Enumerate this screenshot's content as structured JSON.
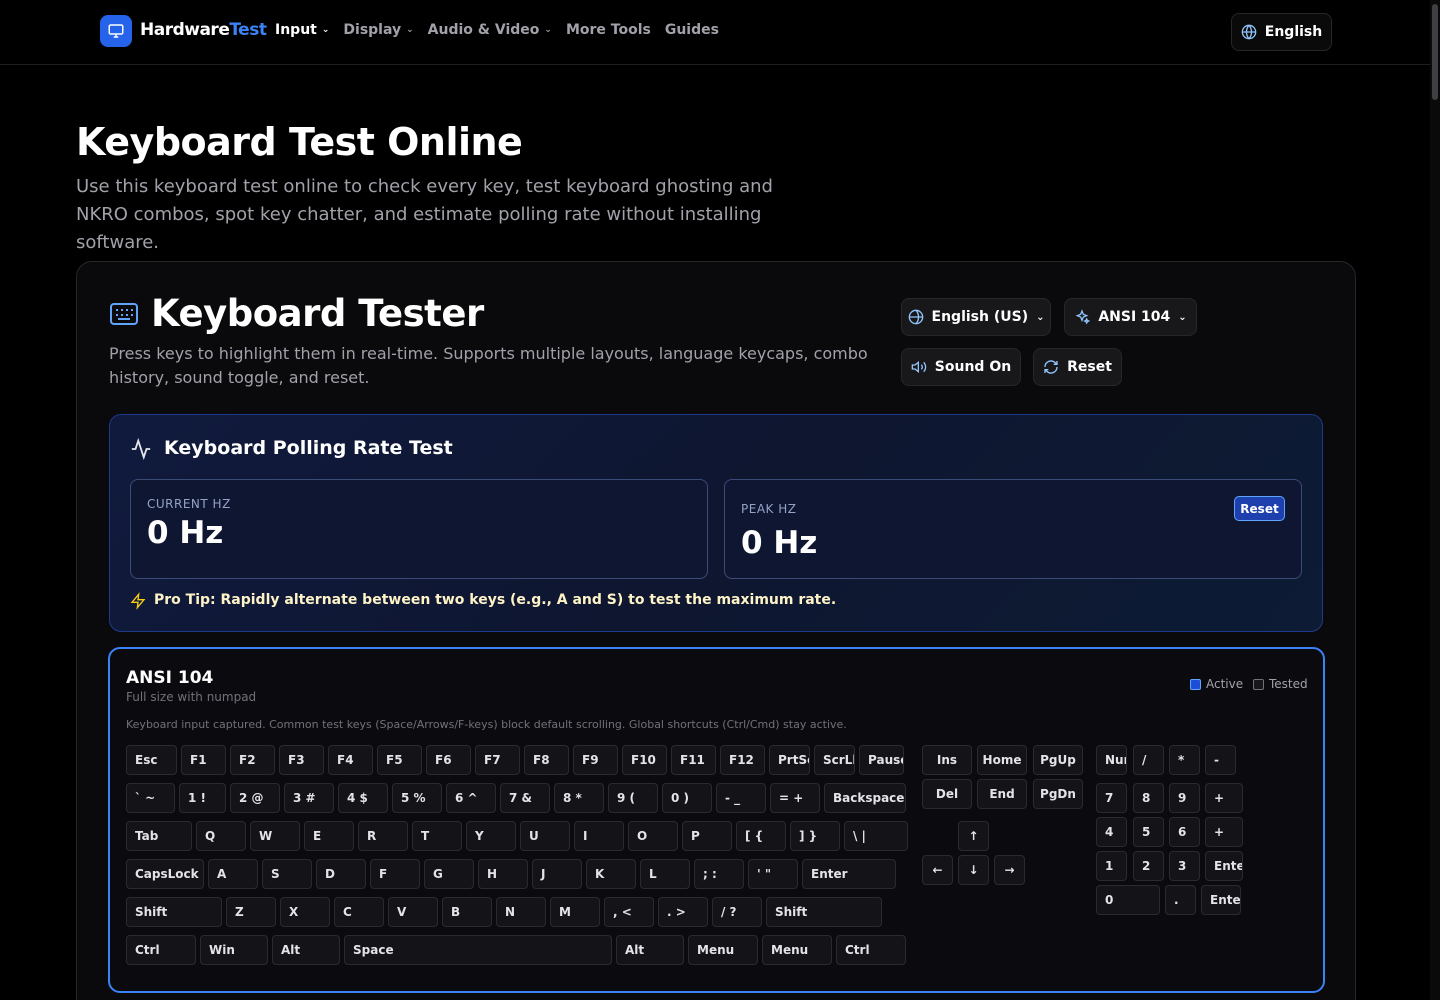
{
  "nav": {
    "brand_part1": "Hardware",
    "brand_part2": "Test",
    "links": [
      {
        "label": "Input",
        "dropdown": true,
        "active": true
      },
      {
        "label": "Display",
        "dropdown": true,
        "active": false
      },
      {
        "label": "Audio & Video",
        "dropdown": true,
        "active": false
      },
      {
        "label": "More Tools",
        "dropdown": false,
        "active": false
      },
      {
        "label": "Guides",
        "dropdown": false,
        "active": false
      }
    ],
    "language": "English"
  },
  "hero": {
    "title": "Keyboard Test Online",
    "lead": "Use this keyboard test online to check every key, test keyboard ghosting and NKRO combos, spot key chatter, and estimate polling rate without installing software."
  },
  "tester": {
    "title": "Keyboard Tester",
    "description": "Press keys to highlight them in real-time. Supports multiple layouts, language keycaps, combo history, sound toggle, and reset.",
    "language_select": "English (US)",
    "layout_select": "ANSI 104",
    "sound_button": "Sound On",
    "reset_button": "Reset"
  },
  "polling": {
    "title": "Keyboard Polling Rate Test",
    "current_label": "CURRENT HZ",
    "current_value": "0 Hz",
    "peak_label": "PEAK HZ",
    "peak_value": "0 Hz",
    "reset_label": "Reset",
    "tip": "Pro Tip: Rapidly alternate between two keys (e.g., A and S) to test the maximum rate."
  },
  "keyboard": {
    "title": "ANSI 104",
    "subtitle": "Full size with numpad",
    "note": "Keyboard input captured. Common test keys (Space/Arrows/F-keys) block default scrolling. Global shortcuts (Ctrl/Cmd) stay active.",
    "legend_active": "Active",
    "legend_tested": "Tested",
    "main_rows": [
      [
        "Esc",
        "F1",
        "F2",
        "F3",
        "F4",
        "F5",
        "F6",
        "F7",
        "F8",
        "F9",
        "F10",
        "F11",
        "F12",
        "PrtSc",
        "ScrLk",
        "Pause"
      ],
      [
        "` ~",
        "1 !",
        "2 @",
        "3 #",
        "4 $",
        "5 %",
        "6 ^",
        "7 &",
        "8 *",
        "9 (",
        "0 )",
        "- _",
        "= +",
        "Backspace"
      ],
      [
        "Tab",
        "Q",
        "W",
        "E",
        "R",
        "T",
        "Y",
        "U",
        "I",
        "O",
        "P",
        "[ {",
        "] }",
        "\\ |"
      ],
      [
        "CapsLock",
        "A",
        "S",
        "D",
        "F",
        "G",
        "H",
        "J",
        "K",
        "L",
        "; :",
        "' \"",
        "Enter"
      ],
      [
        "Shift",
        "Z",
        "X",
        "C",
        "V",
        "B",
        "N",
        "M",
        ", <",
        ". >",
        "/ ?",
        "Shift"
      ],
      [
        "Ctrl",
        "Win",
        "Alt",
        "Space",
        "Alt",
        "Menu",
        "Menu",
        "Ctrl"
      ]
    ],
    "nav_cluster": [
      [
        "Ins",
        "Home",
        "PgUp"
      ],
      [
        "Del",
        "End",
        "PgDn"
      ]
    ],
    "arrows": [
      "↑",
      "←",
      "↓",
      "→"
    ],
    "numpad": [
      [
        "Num",
        "/",
        "*",
        "-"
      ],
      [
        "7",
        "8",
        "9",
        "+"
      ],
      [
        "4",
        "5",
        "6",
        "+"
      ],
      [
        "1",
        "2",
        "3",
        "Enter"
      ],
      [
        "0",
        ".",
        "Enter"
      ]
    ]
  },
  "colors": {
    "accent": "#3b82f6",
    "background": "#000000",
    "muted_text": "#a1a1aa",
    "tip_icon": "#facc15"
  }
}
